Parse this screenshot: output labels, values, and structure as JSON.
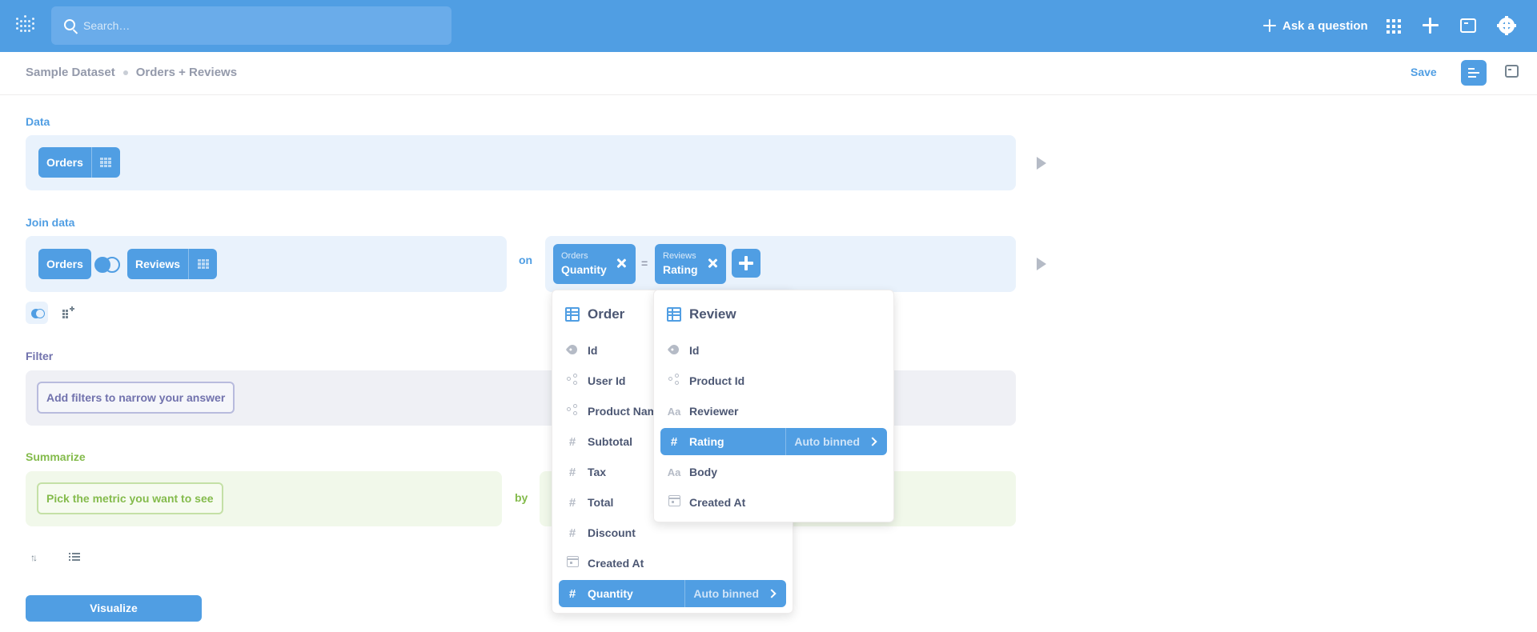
{
  "navbar": {
    "search_placeholder": "Search…",
    "ask_label": "Ask a question",
    "icons": [
      "logo-icon",
      "search-icon",
      "sparkle-icon",
      "grid-icon",
      "plus-icon",
      "console-icon",
      "gear-icon"
    ]
  },
  "header": {
    "breadcrumb": [
      "Sample Dataset",
      "Orders + Reviews"
    ],
    "save_label": "Save"
  },
  "data_step": {
    "label": "Data",
    "table": "Orders"
  },
  "join_step": {
    "label": "Join data",
    "left_table": "Orders",
    "right_table": "Reviews",
    "on_label": "on",
    "left_condition": {
      "table": "Orders",
      "field": "Quantity"
    },
    "operator": "=",
    "right_condition": {
      "table": "Reviews",
      "field": "Rating"
    }
  },
  "filter_step": {
    "label": "Filter",
    "placeholder": "Add filters to narrow your answer"
  },
  "summarize_step": {
    "label": "Summarize",
    "metric_placeholder": "Pick the metric you want to see",
    "by_label": "by"
  },
  "visualize_label": "Visualize",
  "order_popover": {
    "title": "Order",
    "items": [
      {
        "label": "Id",
        "icon": "tag-icon"
      },
      {
        "label": "User Id",
        "icon": "connections-icon"
      },
      {
        "label": "Product Name",
        "icon": "connections-icon"
      },
      {
        "label": "Subtotal",
        "icon": "hash-icon"
      },
      {
        "label": "Tax",
        "icon": "hash-icon"
      },
      {
        "label": "Total",
        "icon": "hash-icon"
      },
      {
        "label": "Discount",
        "icon": "hash-icon"
      },
      {
        "label": "Created At",
        "icon": "calendar-icon"
      },
      {
        "label": "Quantity",
        "icon": "hash-icon",
        "selected": true,
        "binning": "Auto binned"
      }
    ]
  },
  "review_popover": {
    "title": "Review",
    "items": [
      {
        "label": "Id",
        "icon": "tag-icon"
      },
      {
        "label": "Product Id",
        "icon": "connections-icon"
      },
      {
        "label": "Reviewer",
        "icon": "text-icon"
      },
      {
        "label": "Rating",
        "icon": "hash-icon",
        "selected": true,
        "binning": "Auto binned"
      },
      {
        "label": "Body",
        "icon": "text-icon"
      },
      {
        "label": "Created At",
        "icon": "calendar-icon"
      }
    ]
  },
  "glyphs": {
    "hash": "#",
    "text": "Aa"
  },
  "colors": {
    "brand": "#509ee3",
    "filter": "#7172ad",
    "summarize": "#84bb4c",
    "text": "#4c5773"
  }
}
